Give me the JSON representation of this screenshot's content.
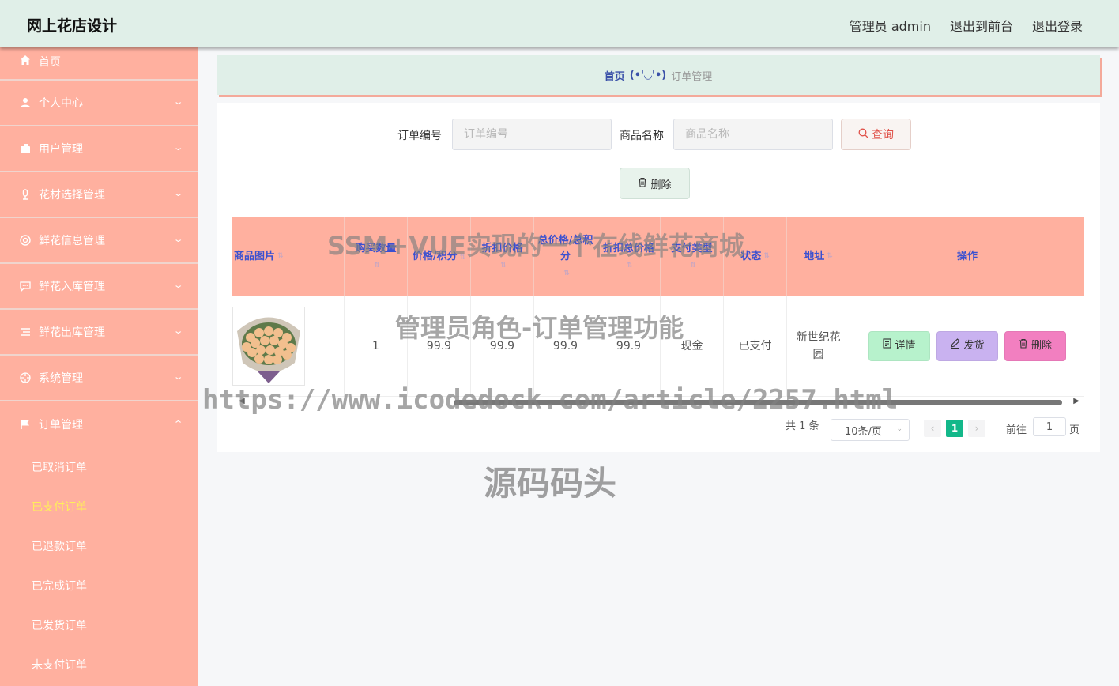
{
  "header": {
    "brand": "网上花店设计",
    "user_label": "管理员 admin",
    "front_link": "退出到前台",
    "logout_link": "退出登录"
  },
  "sidebar": {
    "items": [
      {
        "label": "首页",
        "icon": "home-icon"
      },
      {
        "label": "个人中心",
        "icon": "user-icon"
      },
      {
        "label": "用户管理",
        "icon": "wallet-icon"
      },
      {
        "label": "花材选择管理",
        "icon": "microphone-icon"
      },
      {
        "label": "鲜花信息管理",
        "icon": "lifebuoy-icon"
      },
      {
        "label": "鲜花入库管理",
        "icon": "chat-icon"
      },
      {
        "label": "鲜花出库管理",
        "icon": "list-icon"
      },
      {
        "label": "系统管理",
        "icon": "crosshair-icon"
      },
      {
        "label": "订单管理",
        "icon": "flag-icon"
      }
    ],
    "sub_items": [
      "已取消订单",
      "已支付订单",
      "已退款订单",
      "已完成订单",
      "已发货订单",
      "未支付订单"
    ],
    "active_sub": "已支付订单"
  },
  "breadcrumb": {
    "home": "首页",
    "separator": "(•'◡'•)",
    "current": "订单管理"
  },
  "search": {
    "order_no_label": "订单编号",
    "order_no_placeholder": "订单编号",
    "product_label": "商品名称",
    "product_placeholder": "商品名称",
    "query_button": "查询",
    "delete_button": "删除"
  },
  "table": {
    "columns": [
      "商品图片",
      "购买数量",
      "价格/积分",
      "折扣价格",
      "总价格/总积分",
      "折扣总价格",
      "支付类型",
      "状态",
      "地址",
      "操作"
    ],
    "rows": [
      {
        "quantity": "1",
        "price": "99.9",
        "discount_price": "99.9",
        "total_price": "99.9",
        "discount_total": "99.9",
        "pay_type": "现金",
        "status": "已支付",
        "address": "新世纪花园"
      }
    ],
    "actions": {
      "detail": "详情",
      "ship": "发货",
      "delete": "删除"
    }
  },
  "pagination": {
    "total_text": "共 1 条",
    "page_size": "10条/页",
    "current_page": "1",
    "goto_label": "前往",
    "goto_value": "1",
    "page_unit": "页"
  },
  "watermarks": {
    "title": "SSM+VUE实现的一个在线鲜花商城",
    "subtitle": "管理员角色-订单管理功能",
    "url": "https://www.icodedock.com/article/2257.html",
    "brand": "源码码头"
  },
  "colors": {
    "header_bg": "#e0efe8",
    "sidebar_bg": "#ffb09f",
    "active_sub": "#ffef5a",
    "table_header_bg": "#ffb09f",
    "header_text": "#3a50d0",
    "pager_active": "#13b88a"
  }
}
